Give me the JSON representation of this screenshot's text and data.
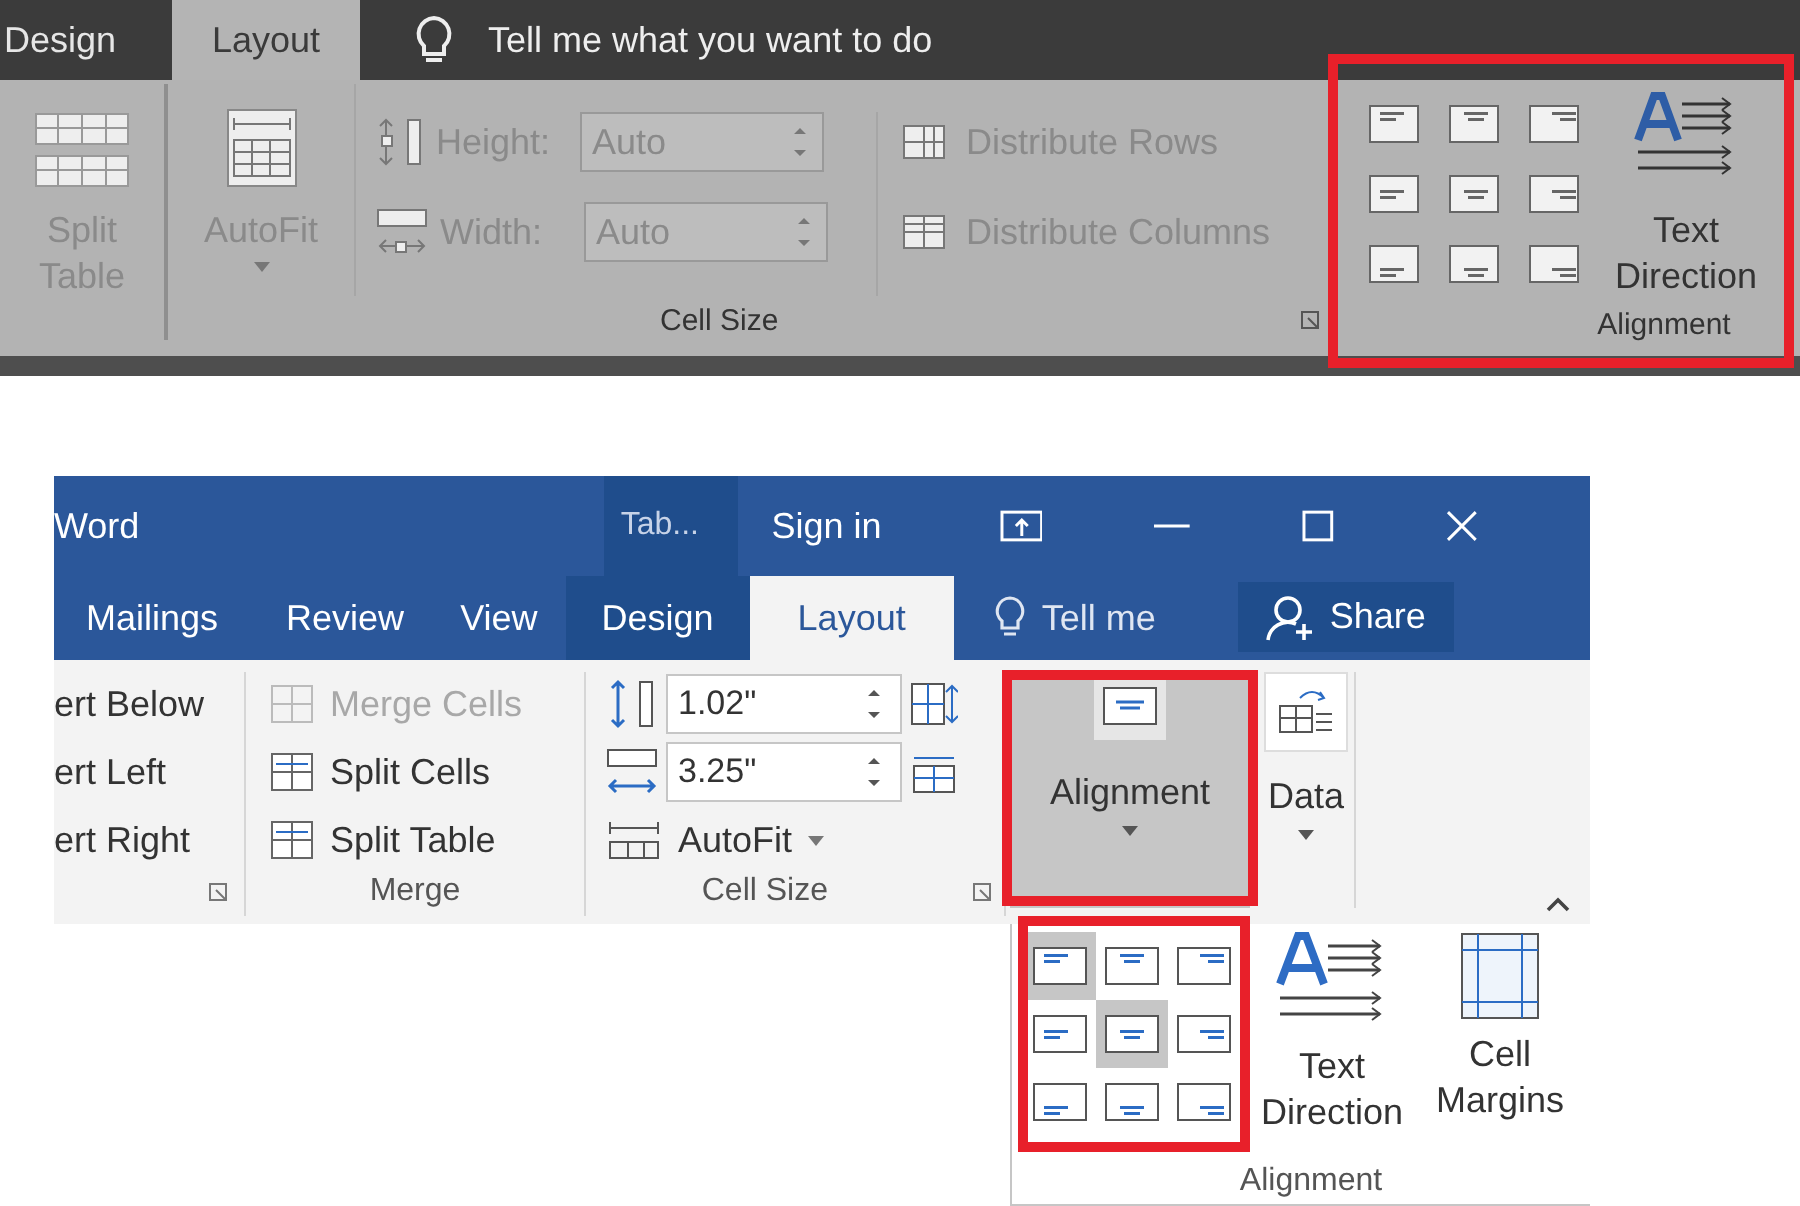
{
  "top_screenshot": {
    "tabs": [
      {
        "label": "Design",
        "selected": false
      },
      {
        "label": "Layout",
        "selected": true
      }
    ],
    "tell_me": {
      "placeholder": "Tell me what you want to do"
    },
    "split_table": {
      "label": "Split Table"
    },
    "autofit": {
      "label": "AutoFit"
    },
    "height": {
      "label": "Height:",
      "value": "Auto"
    },
    "width": {
      "label": "Width:",
      "value": "Auto"
    },
    "distribute_rows": "Distribute Rows",
    "distribute_columns": "Distribute Columns",
    "cell_size_label": "Cell Size",
    "alignment_group": {
      "highlighted": true,
      "text_direction": "Text Direction",
      "label": "Alignment"
    }
  },
  "bottom_screenshot": {
    "app_title": "Word",
    "context_tab": "Tab...",
    "sign_in": "Sign in",
    "tabs": [
      {
        "label": "Mailings",
        "selected": false,
        "contextual": false
      },
      {
        "label": "Review",
        "selected": false,
        "contextual": false
      },
      {
        "label": "View",
        "selected": false,
        "contextual": false
      },
      {
        "label": "Design",
        "selected": false,
        "contextual": true
      },
      {
        "label": "Layout",
        "selected": true,
        "contextual": true
      }
    ],
    "tell_me": "Tell me",
    "share": "Share",
    "rows_group": [
      "ert Below",
      "ert Left",
      "ert Right"
    ],
    "merge_group": {
      "items": [
        {
          "label": "Merge Cells",
          "disabled": true
        },
        {
          "label": "Split Cells",
          "disabled": false
        },
        {
          "label": "Split Table",
          "disabled": false
        }
      ],
      "label": "Merge"
    },
    "cell_size": {
      "height": "1.02\"",
      "width": "3.25\"",
      "autofit": "AutoFit",
      "label": "Cell Size"
    },
    "alignment_button": {
      "label": "Alignment",
      "pressed": true,
      "highlighted": true
    },
    "data_button": {
      "label": "Data"
    },
    "dropdown": {
      "highlighted": true,
      "cells": [
        {
          "selected": true
        },
        {
          "selected": false
        },
        {
          "selected": false
        },
        {
          "selected": false
        },
        {
          "selected": true
        },
        {
          "selected": false
        },
        {
          "selected": false
        },
        {
          "selected": false
        },
        {
          "selected": false
        }
      ],
      "text_direction": "Text Direction",
      "cell_margins": "Cell Margins",
      "label": "Alignment"
    }
  }
}
